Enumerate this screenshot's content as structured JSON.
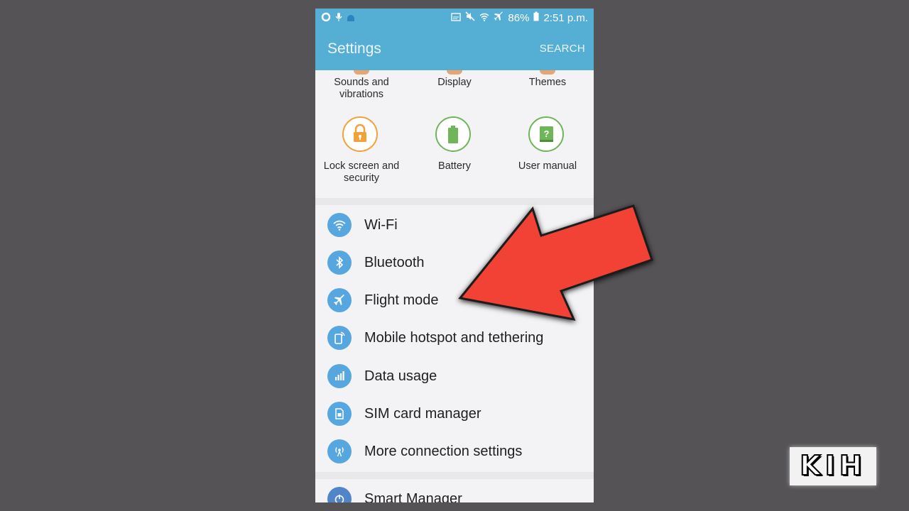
{
  "status_bar": {
    "battery": "86%",
    "time": "2:51 p.m.",
    "icons_left": [
      "circle-notification-icon",
      "mic-icon",
      "android-icon"
    ],
    "icons_right": [
      "cast-icon",
      "mute-icon",
      "wifi-icon",
      "airplane-icon",
      "battery-icon"
    ]
  },
  "app_bar": {
    "title": "Settings",
    "search_label": "SEARCH"
  },
  "grid": {
    "row1": [
      {
        "label_line1": "Sounds and",
        "label_line2": "vibrations"
      },
      {
        "label_line1": "Display",
        "label_line2": ""
      },
      {
        "label_line1": "Themes",
        "label_line2": ""
      }
    ],
    "row2": [
      {
        "label_line1": "Lock screen and",
        "label_line2": "security",
        "icon": "lock-icon",
        "color": "#efa33a"
      },
      {
        "label_line1": "Battery",
        "label_line2": "",
        "icon": "battery-icon",
        "color": "#6fb55a"
      },
      {
        "label_line1": "User manual",
        "label_line2": "",
        "icon": "help-book-icon",
        "color": "#6fb55a"
      }
    ]
  },
  "connections": [
    {
      "label": "Wi-Fi",
      "icon": "wifi-icon"
    },
    {
      "label": "Bluetooth",
      "icon": "bluetooth-icon"
    },
    {
      "label": "Flight mode",
      "icon": "airplane-icon"
    },
    {
      "label": "Mobile hotspot and tethering",
      "icon": "hotspot-icon"
    },
    {
      "label": "Data usage",
      "icon": "bar-chart-icon"
    },
    {
      "label": "SIM card manager",
      "icon": "sim-card-icon"
    },
    {
      "label": "More connection settings",
      "icon": "antenna-icon"
    }
  ],
  "next_section": {
    "label": "Smart Manager",
    "icon": "smart-manager-icon"
  },
  "overlay": {
    "arrow_color": "#f24236",
    "logo_text": "KIH"
  },
  "colors": {
    "accent": "#55aed3",
    "list_icon": "#56a7e0"
  }
}
